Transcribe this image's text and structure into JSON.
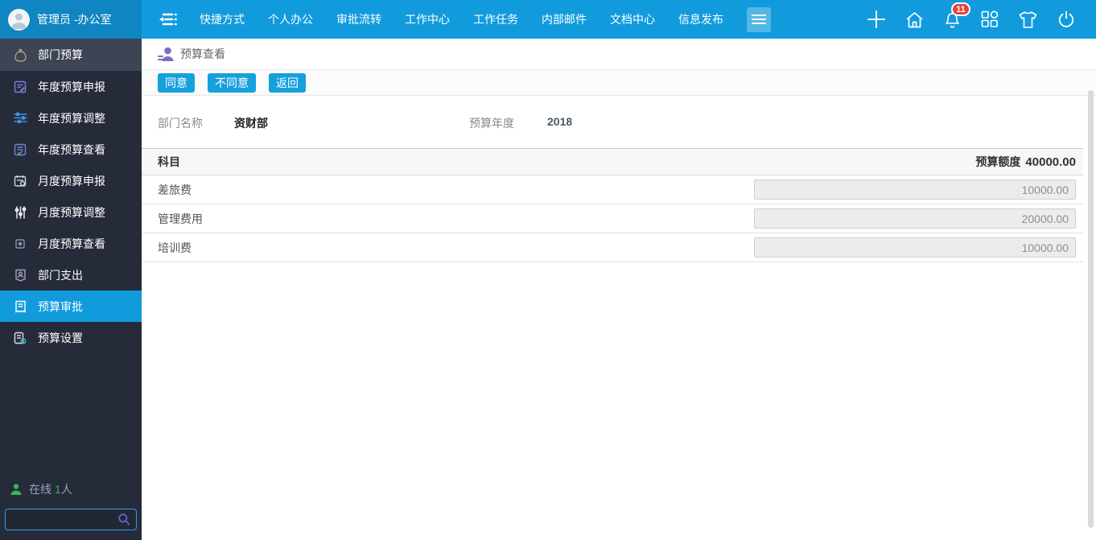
{
  "topbar": {
    "user_name": "管理员 -办公室",
    "nav": [
      "快捷方式",
      "个人办公",
      "审批流转",
      "工作中心",
      "工作任务",
      "内部邮件",
      "文档中心",
      "信息发布"
    ],
    "notification_count": "11"
  },
  "sidebar": {
    "items": [
      {
        "label": "部门预算"
      },
      {
        "label": "年度预算申报"
      },
      {
        "label": "年度预算调整"
      },
      {
        "label": "年度预算查看"
      },
      {
        "label": "月度预算申报"
      },
      {
        "label": "月度预算调整"
      },
      {
        "label": "月度预算查看"
      },
      {
        "label": "部门支出"
      },
      {
        "label": "预算审批"
      },
      {
        "label": "预算设置"
      }
    ],
    "active_item": "预算审批",
    "online": {
      "prefix": "在线",
      "count": "1",
      "suffix": "人"
    },
    "search_placeholder": ""
  },
  "breadcrumb": {
    "title": "预算查看"
  },
  "toolbar": {
    "agree": "同意",
    "disagree": "不同意",
    "back": "返回"
  },
  "form": {
    "dept_label": "部门名称",
    "dept_value": "资财部",
    "year_label": "预算年度",
    "year_value": "2018"
  },
  "table": {
    "subject_header": "科目",
    "amount_header": "预算额度",
    "total_amount": "40000.00",
    "rows": [
      {
        "subject": "差旅费",
        "amount": "10000.00"
      },
      {
        "subject": "管理费用",
        "amount": "20000.00"
      },
      {
        "subject": "培训费",
        "amount": "10000.00"
      }
    ]
  },
  "icons": {
    "topbar": [
      "menu-fold-icon",
      "apps-menu-icon",
      "plus-icon",
      "home-icon",
      "bell-icon",
      "modules-grid-icon",
      "theme-shirt-icon",
      "power-icon"
    ],
    "sidebar": [
      "money-bag-icon",
      "doc-edit-icon",
      "sliders-h-icon",
      "doc-view-icon",
      "month-report-icon",
      "sliders-v-icon",
      "month-view-icon",
      "expense-badge-icon",
      "approve-doc-icon",
      "settings-doc-icon"
    ],
    "other": [
      "user-list-icon",
      "online-person-icon",
      "search-icon"
    ]
  },
  "colors": {
    "topbar_blue": "#119bdd",
    "topbar_user_blue": "#0f85c2",
    "sidebar_dark": "#262b3a",
    "sidebar_group": "#3d4454",
    "active_blue": "#119bdd",
    "button_blue": "#16a0dc",
    "badge_red": "#e8403a",
    "online_green": "#35b558",
    "breadcrumb_purple": "#7a6fc4",
    "input_grey": "#ececec"
  }
}
